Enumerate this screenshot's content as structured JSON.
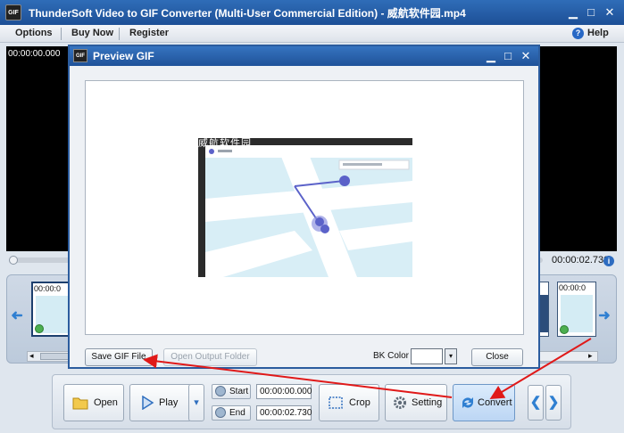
{
  "window": {
    "title": "ThunderSoft Video to GIF Converter (Multi-User Commercial Edition) - 威航软件园.mp4",
    "app_icon_text": "GIF",
    "minimize_glyph": "▁",
    "maximize_glyph": "□",
    "close_glyph": "✕"
  },
  "menu": {
    "items": [
      "Options",
      "Buy Now",
      "Register"
    ],
    "help_label": "Help",
    "help_icon_glyph": "?"
  },
  "player": {
    "current_time": "00:00:00.000",
    "end_time": "00:00:02.730",
    "info_icon_glyph": "i",
    "position_fraction": 0.0
  },
  "filmstrip": {
    "frame_time": "00:00:0",
    "left_arrow_glyph": "➜",
    "right_arrow_glyph": "➜",
    "scroll_left_glyph": "◂",
    "scroll_right_glyph": "▸"
  },
  "toolbar": {
    "open_label": "Open",
    "play_label": "Play",
    "play_dropdown_glyph": "▾",
    "start_label": "Start",
    "end_label": "End",
    "start_value": "00:00:00.000",
    "end_value": "00:00:02.730",
    "crop_label": "Crop",
    "setting_label": "Setting",
    "convert_label": "Convert",
    "prev_glyph": "❮",
    "next_glyph": "❯"
  },
  "dialog": {
    "title": "Preview GIF",
    "icon_text": "GIF",
    "minimize_glyph": "▁",
    "maximize_glyph": "□",
    "close_glyph": "✕",
    "watermark": "威航软件园",
    "save_label": "Save GIF File",
    "open_output_label": "Open Output Folder",
    "bk_color_label": "BK Color",
    "bk_color_value": "#ffffff",
    "close_label": "Close",
    "dropdown_glyph": "▾"
  },
  "colors": {
    "title_bar": "#1d4f96",
    "annotation_arrow": "#e01919",
    "map_water": "#d8eef6",
    "route": "#5b62c9"
  }
}
